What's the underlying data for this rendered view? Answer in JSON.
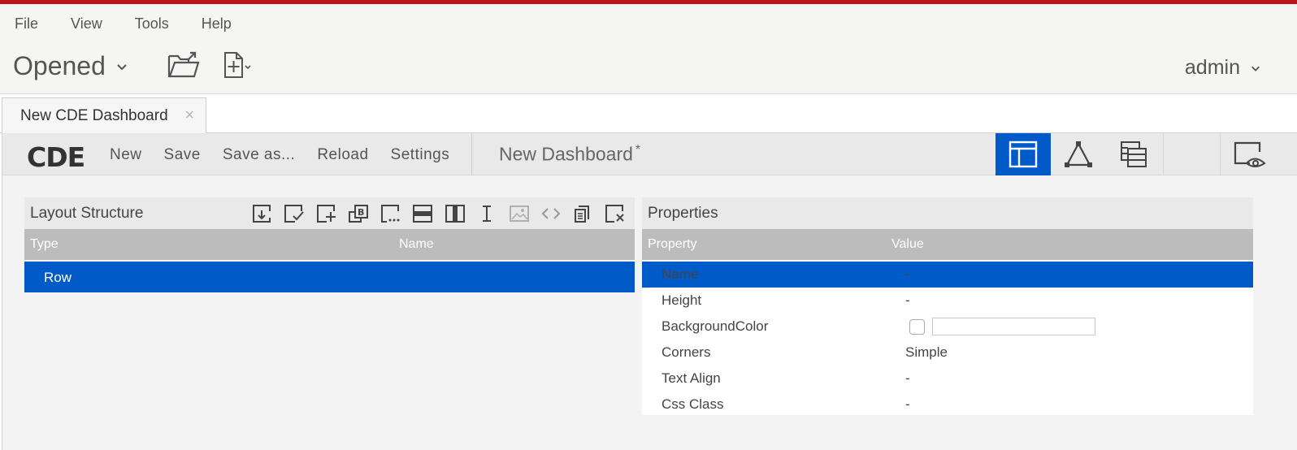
{
  "menubar": {
    "items": [
      "File",
      "View",
      "Tools",
      "Help"
    ]
  },
  "toolbar": {
    "opened_label": "Opened",
    "user_label": "admin"
  },
  "tabs": [
    {
      "label": "New CDE Dashboard",
      "close": "×"
    }
  ],
  "cde": {
    "logo": "CDE",
    "menu": [
      "New",
      "Save",
      "Save as...",
      "Reload",
      "Settings"
    ],
    "dashboard_title": "New Dashboard",
    "unsaved_marker": "*",
    "views": [
      {
        "name": "layout-view-icon",
        "active": true
      },
      {
        "name": "components-view-icon",
        "active": false
      },
      {
        "name": "datasources-view-icon",
        "active": false
      },
      {
        "name": "preview-icon",
        "active": false
      }
    ]
  },
  "layout_panel": {
    "title": "Layout Structure",
    "tools": [
      "save-template-icon",
      "apply-template-icon",
      "add-resource-icon",
      "add-bootstrap-panel-icon",
      "add-freeform-icon",
      "add-row-icon",
      "add-column-icon",
      "add-space-icon",
      "add-image-icon",
      "add-html-icon",
      "duplicate-icon",
      "delete-icon"
    ],
    "columns": {
      "type": "Type",
      "name": "Name"
    },
    "rows": [
      {
        "type": "Row",
        "name": "",
        "selected": true
      }
    ]
  },
  "properties_panel": {
    "title": "Properties",
    "columns": {
      "property": "Property",
      "value": "Value"
    },
    "rows": [
      {
        "property": "Name",
        "value": "-",
        "selected": true
      },
      {
        "property": "Height",
        "value": "-"
      },
      {
        "property": "BackgroundColor",
        "value": ""
      },
      {
        "property": "Corners",
        "value": "Simple"
      },
      {
        "property": "Text Align",
        "value": "-"
      },
      {
        "property": "Css Class",
        "value": "-"
      }
    ]
  },
  "colors": {
    "accent": "#005ac8",
    "brand_red": "#c3131a",
    "header_gray": "#bcbcbc"
  }
}
